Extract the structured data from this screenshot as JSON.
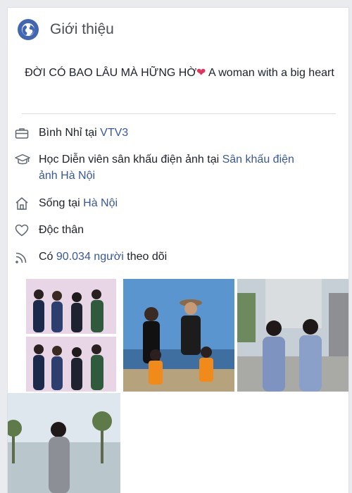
{
  "intro": {
    "title": "Giới thiệu",
    "bio_text": "ĐỜI CÓ BAO LÂU MÀ HỮNG HỜ",
    "bio_emoji": "❤",
    "bio_suffix": " A woman with a big heart"
  },
  "details": {
    "work_prefix": "Bình Nhỉ tại ",
    "work_link": "VTV3",
    "study_prefix": "Học Diễn viên sân khấu điện ảnh tại ",
    "study_link": "Sân khấu điện ảnh Hà Nội",
    "live_prefix": "Sống tại ",
    "live_link": "Hà Nội",
    "relationship": "Độc thân",
    "follow_prefix": "Có ",
    "follow_link": "90.034 người",
    "follow_suffix": " theo dõi"
  },
  "icons": {
    "header": "globe-icon",
    "work": "briefcase-icon",
    "study": "graduation-cap-icon",
    "live": "home-icon",
    "relationship": "heart-icon",
    "follow": "rss-icon"
  },
  "colors": {
    "link": "#385898",
    "globe": "#4267b2",
    "heart": "#e0345c"
  }
}
